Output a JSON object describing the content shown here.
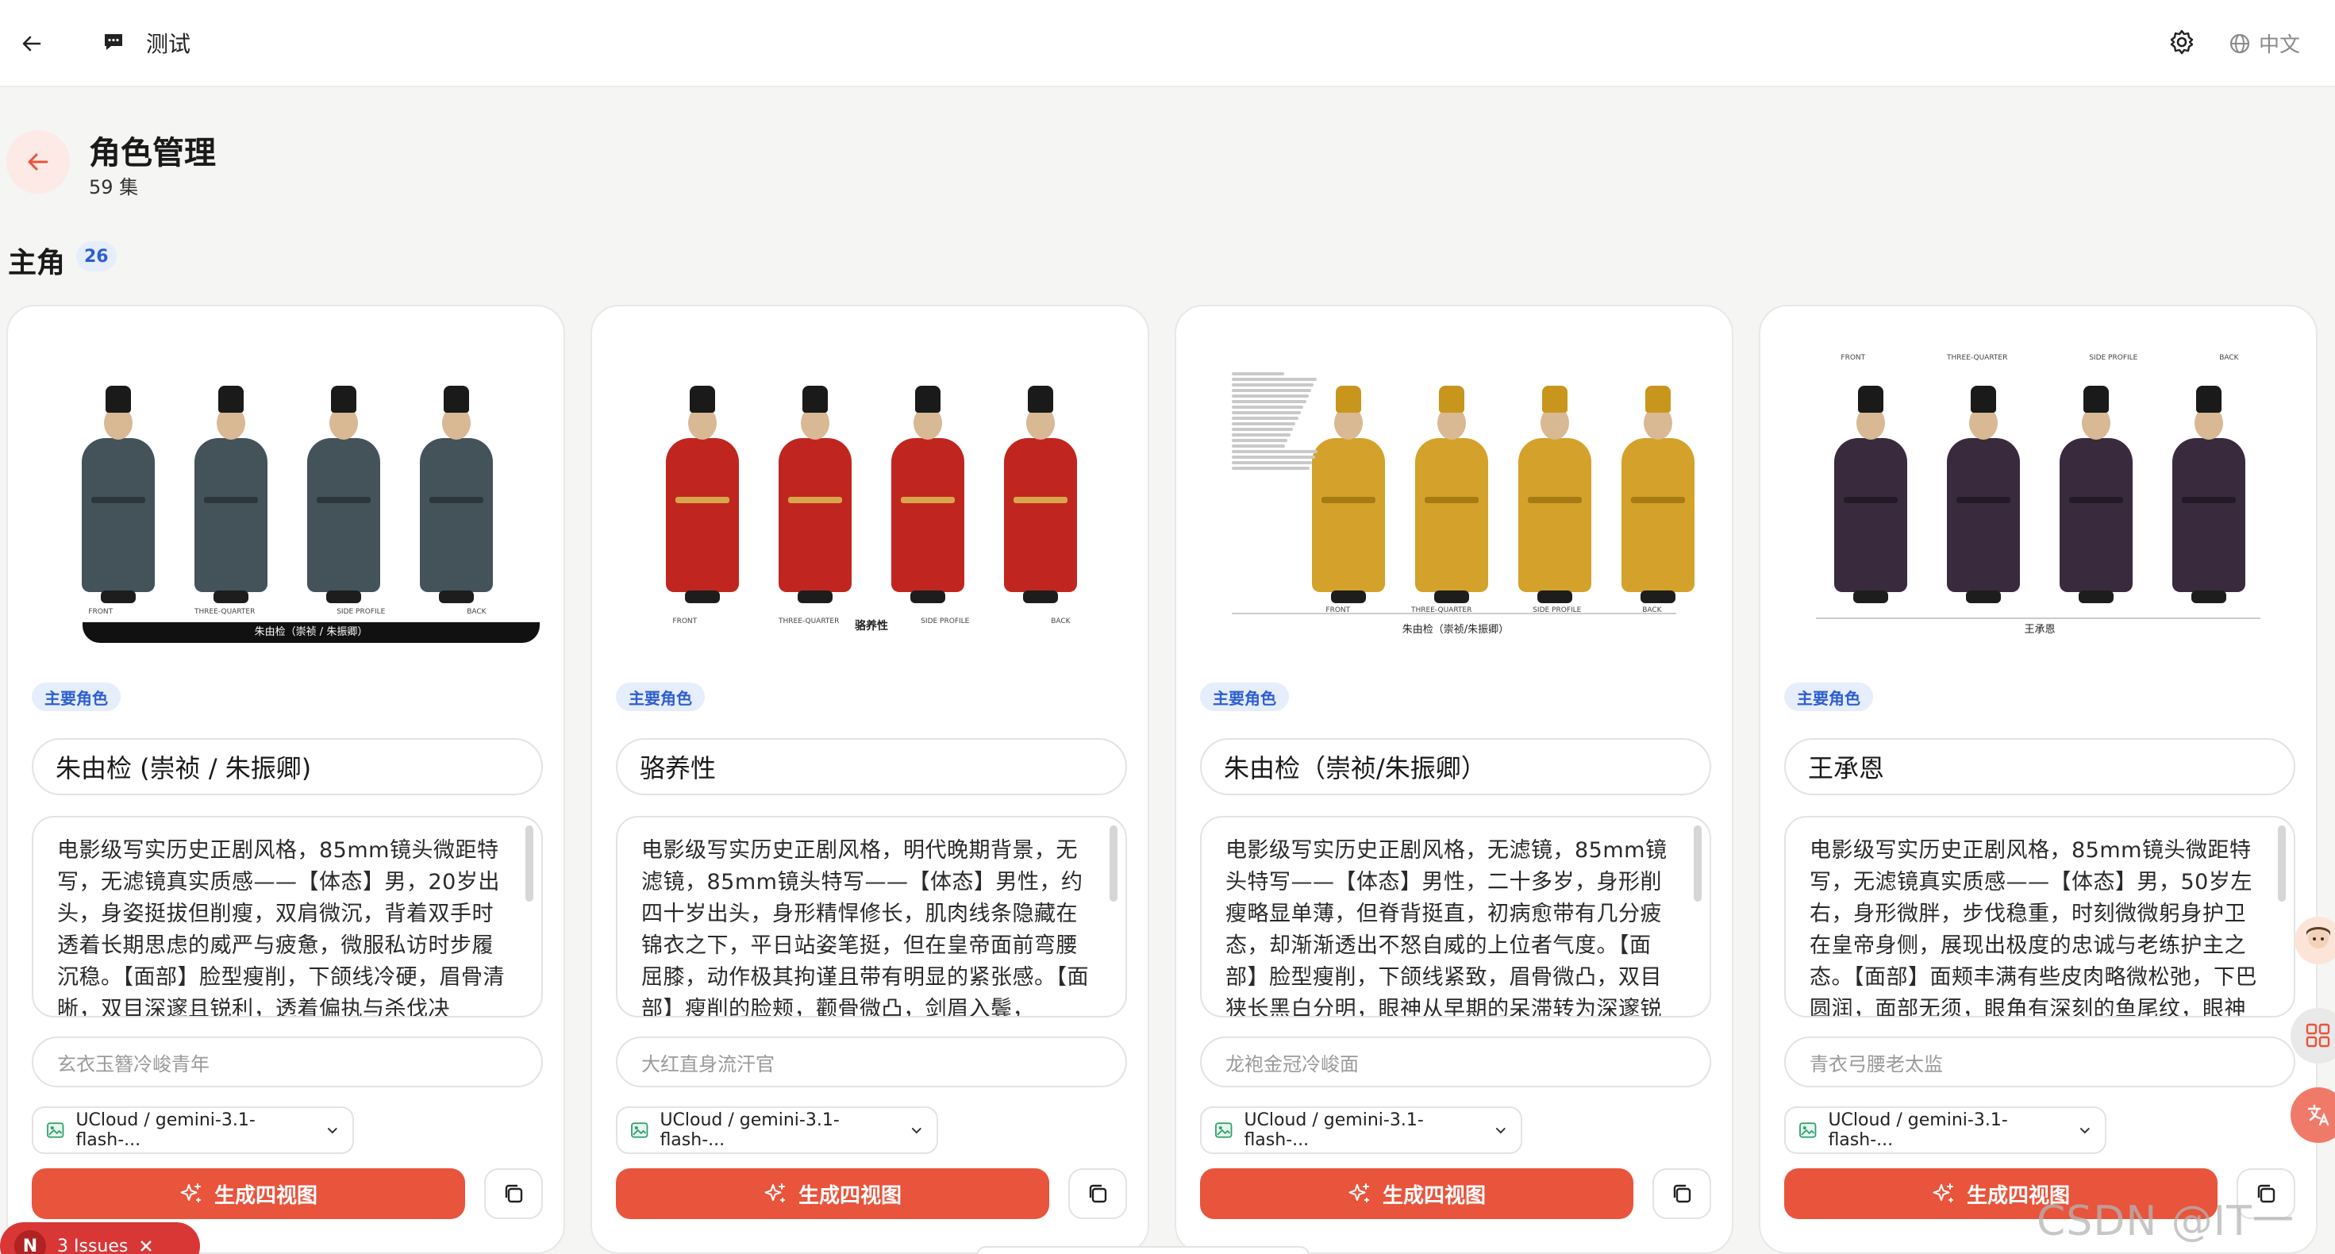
{
  "topbar": {
    "project_title": "测试",
    "language_label": "中文"
  },
  "header": {
    "title": "角色管理",
    "subtitle": "59 集"
  },
  "section": {
    "title": "主角",
    "count": "26"
  },
  "cards": [
    {
      "tag": "主要角色",
      "name": "朱由检 (崇祯 / 朱振卿)",
      "description": "电影级写实历史正剧风格，85mm镜头微距特写，无滤镜真实质感——【体态】男，20岁出头，身姿挺拔但削瘦，双肩微沉，背着双手时透着长期思虑的威严与疲惫，微服私访时步履沉稳。【面部】脸型瘦削，下颌线冷硬，眉骨清晰，双目深邃且锐利，透着偏执与杀伐决",
      "short_desc": "玄衣玉簪冷峻青年",
      "model": "UCloud / gemini-3.1-flash-...",
      "generate_label": "生成四视图",
      "sheet_caption": "朱由检（崇祯 / 朱振卿）",
      "view_labels": [
        "FRONT",
        "THREE-QUARTER",
        "SIDE PROFILE",
        "BACK"
      ],
      "robe_color": "#44525a",
      "trim_color": "#2c363c",
      "hat_color": "#1a1a1a"
    },
    {
      "tag": "主要角色",
      "name": "骆养性",
      "description": "电影级写实历史正剧风格，明代晚期背景，无滤镜，85mm镜头特写——【体态】男性，约四十岁出头，身形精悍修长，肌肉线条隐藏在锦衣之下，平日站姿笔挺，但在皇帝面前弯腰屈膝，动作极其拘谨且带有明显的紧张感。【面部】瘦削的脸颊，颧骨微凸，剑眉入鬓，",
      "short_desc": "大红直身流汗官",
      "model": "UCloud / gemini-3.1-flash-...",
      "generate_label": "生成四视图",
      "sheet_caption": "骆养性",
      "view_labels": [
        "FRONT",
        "THREE-QUARTER",
        "SIDE PROFILE",
        "BACK"
      ],
      "robe_color": "#c0261f",
      "trim_color": "#d8a64a",
      "hat_color": "#1a1a1a"
    },
    {
      "tag": "主要角色",
      "name": "朱由检（崇祯/朱振卿）",
      "description": "电影级写实历史正剧风格，无滤镜，85mm镜头特写——【体态】男性，二十多岁，身形削瘦略显单薄，但脊背挺直，初病愈带有几分疲态，却渐渐透出不怒自威的上位者气度。【面部】脸型瘦削，下颌线紧致，眉骨微凸，双目狭长黑白分明，眼神从早期的呆滞转为深邃锐",
      "short_desc": "龙袍金冠冷峻面",
      "model": "UCloud / gemini-3.1-flash-...",
      "generate_label": "生成四视图",
      "sheet_caption": "朱由检（崇祯/朱振卿）",
      "view_labels": [
        "FRONT",
        "THREE-QUARTER",
        "SIDE PROFILE",
        "BACK"
      ],
      "robe_color": "#d4a12a",
      "trim_color": "#a87a14",
      "hat_color": "#c8961c"
    },
    {
      "tag": "主要角色",
      "name": "王承恩",
      "description": "电影级写实历史正剧风格，85mm镜头微距特写，无滤镜真实质感——【体态】男，50岁左右，身形微胖，步伐稳重，时刻微微躬身护卫在皇帝身侧，展现出极度的忠诚与老练护主之态。【面部】面颊丰满有些皮肉略微松弛，下巴圆润，面部无须，眼角有深刻的鱼尾纹，眼神",
      "short_desc": "青衣弓腰老太监",
      "model": "UCloud / gemini-3.1-flash-...",
      "generate_label": "生成四视图",
      "sheet_caption": "王承恩",
      "view_labels": [
        "FRONT",
        "THREE-QUARTER",
        "SIDE PROFILE",
        "BACK"
      ],
      "robe_color": "#3a2a3e",
      "trim_color": "#241a28",
      "hat_color": "#1a1a1a"
    }
  ],
  "footer": {
    "issues_count": "N",
    "issues_label": "3 Issues",
    "watermark": "CSDN @IT一氪"
  }
}
